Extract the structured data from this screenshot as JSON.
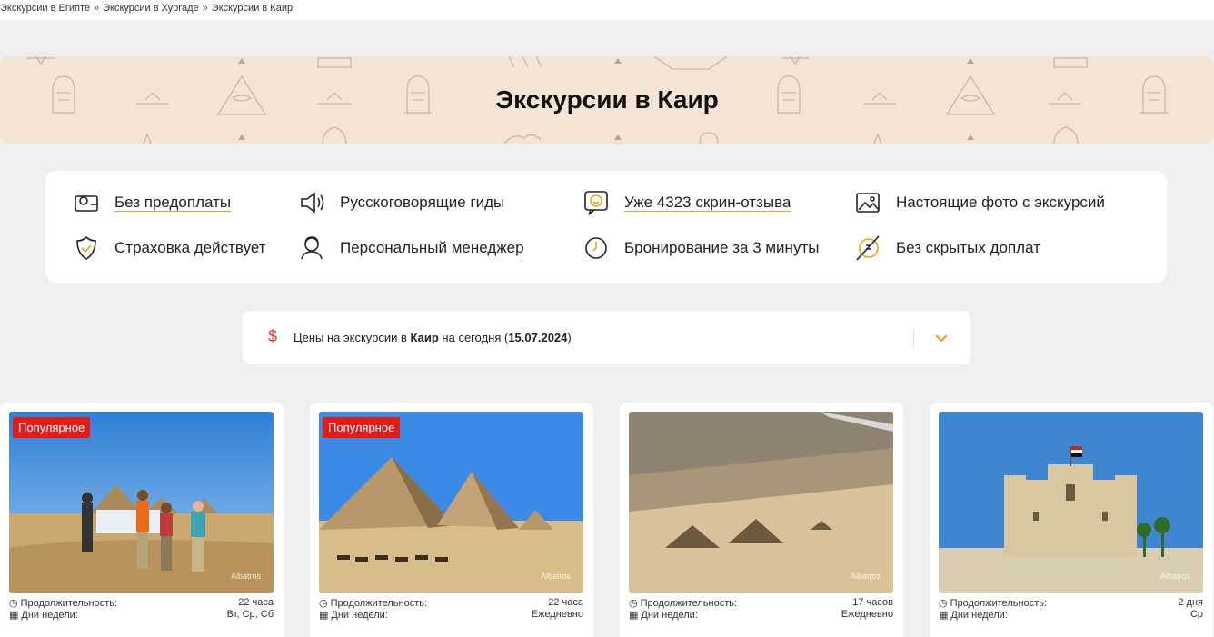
{
  "breadcrumb": [
    "Экскурсии в Египте",
    "Экскурсии в Хургаде",
    "Экскурсии в Каир"
  ],
  "breadcrumb_sep": "»",
  "hero": {
    "title": "Экскурсии в Каир"
  },
  "features": [
    {
      "label": "Без предоплаты",
      "icon": "wallet-icon",
      "link": true
    },
    {
      "label": "Русскоговорящие гиды",
      "icon": "megaphone-icon",
      "link": false
    },
    {
      "label": "Уже 4323 скрин-отзыва",
      "icon": "smile-chat-icon",
      "link": true
    },
    {
      "label": "Настоящие фото с экскурсий",
      "icon": "photo-icon",
      "link": false
    },
    {
      "label": "Страховка действует",
      "icon": "shield-check-icon",
      "link": false
    },
    {
      "label": "Персональный менеджер",
      "icon": "manager-icon",
      "link": false
    },
    {
      "label": "Бронирование за 3 минуты",
      "icon": "clock-icon",
      "link": false
    },
    {
      "label": "Без скрытых доплат",
      "icon": "no-money-icon",
      "link": false
    }
  ],
  "price": {
    "icon": "$",
    "prefix": "Цены на экскурсии в ",
    "city": "Каир",
    "middle": " на сегодня (",
    "date": "15.07.2024",
    "suffix": ")"
  },
  "cards": [
    {
      "badge": "Популярное",
      "duration_label": "Продолжительность:",
      "duration": "22 часа",
      "days_label": "Дни недели:",
      "days": "Вт, Ср, Сб",
      "watermark": "Albatros"
    },
    {
      "badge": "Популярное",
      "duration_label": "Продолжительность:",
      "duration": "22 часа",
      "days_label": "Дни недели:",
      "days": "Ежедневно",
      "watermark": "Albatros"
    },
    {
      "badge": "",
      "duration_label": "Продолжительность:",
      "duration": "17 часов",
      "days_label": "Дни недели:",
      "days": "Ежедневно",
      "watermark": "Albatros"
    },
    {
      "badge": "",
      "duration_label": "Продолжительность:",
      "duration": "2 дня",
      "days_label": "Дни недели:",
      "days": "Ср",
      "watermark": "Albatros"
    }
  ],
  "colors": {
    "accent": "#f0a020",
    "badge": "#e21b1b",
    "hero_bg": "#f4e4d6",
    "price_icon": "#e03a2a"
  }
}
